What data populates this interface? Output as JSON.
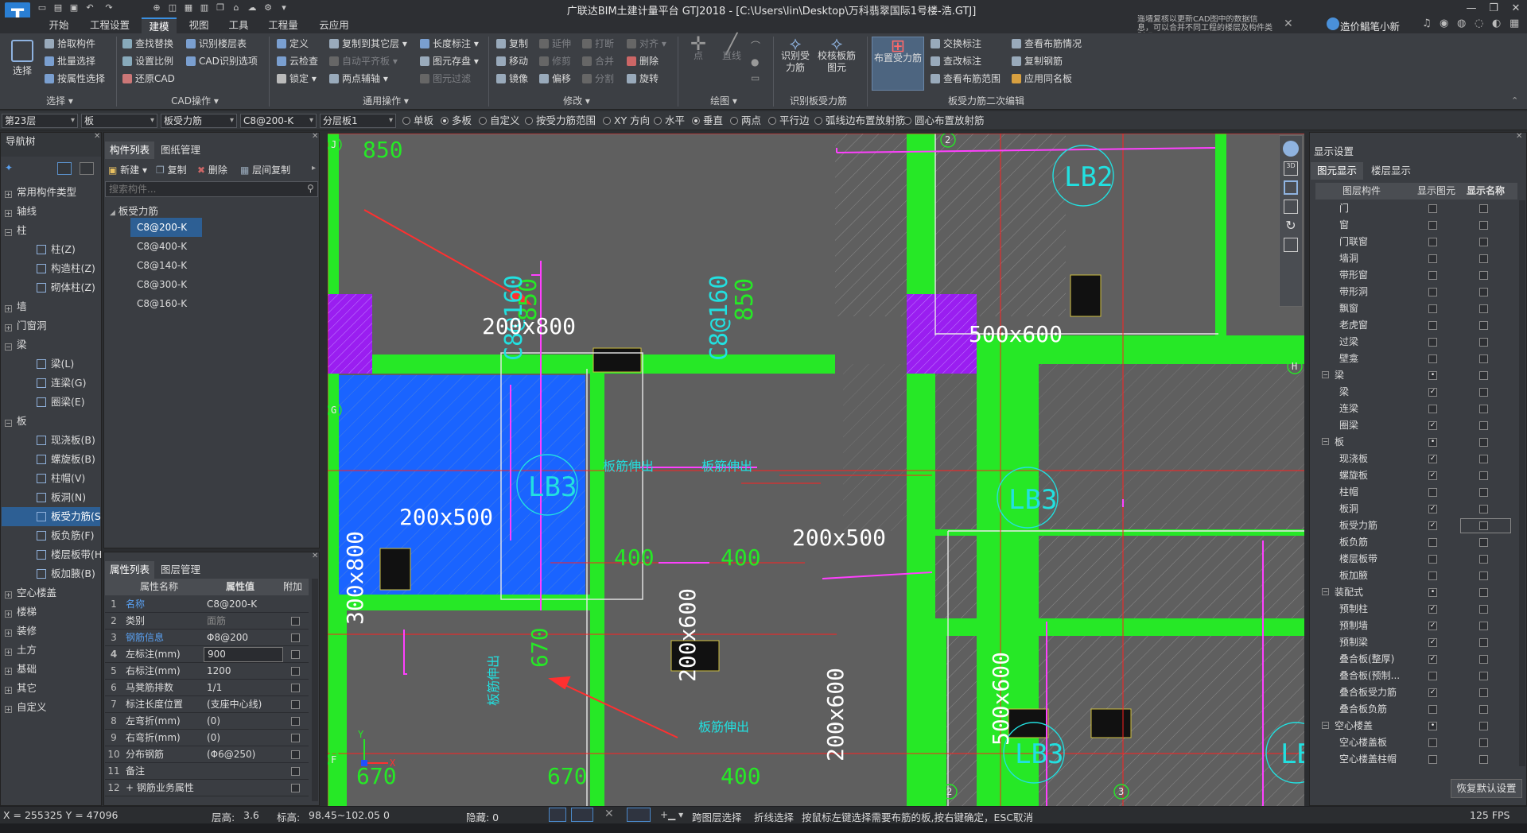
{
  "app": {
    "title": "广联达BIM土建计量平台 GTJ2018 - [C:\\Users\\lin\\Desktop\\万科翡翠国际1号楼-浩.GTJ]",
    "logo": "T",
    "notice": "遥墙复核以更新CAD图中的数据信息，可以合并不同工程的楼层及构件类别吗?",
    "user": "造价鲳笔小新"
  },
  "menu": [
    "开始",
    "工程设置",
    "建模",
    "视图",
    "工具",
    "工程量",
    "云应用"
  ],
  "ribbon": {
    "select": {
      "big": "选择",
      "items": [
        "拾取构件",
        "批量选择",
        "按属性选择"
      ],
      "group": "选择"
    },
    "cad": {
      "items": [
        "查找替换",
        "识别楼层表",
        "设置比例",
        "CAD识别选项",
        "还原CAD"
      ],
      "group": "CAD操作"
    },
    "general": {
      "items": [
        "定义",
        "复制到其它层",
        "长度标注",
        "云检查",
        "自动平齐板",
        "图元存盘",
        "锁定",
        "两点辅轴",
        "图元过滤"
      ],
      "group": "通用操作"
    },
    "modify": {
      "items": [
        "复制",
        "延伸",
        "打断",
        "对齐",
        "移动",
        "修剪",
        "合并",
        "删除",
        "镜像",
        "偏移",
        "分割",
        "旋转"
      ],
      "group": "修改"
    },
    "draw": {
      "items": [
        "点",
        "直线"
      ],
      "group": "绘图"
    },
    "recog": {
      "items": [
        "识别受力筋",
        "校核板筋图元"
      ],
      "group": "识别板受力筋"
    },
    "layout": {
      "big": "布置受力筋",
      "items": [
        "交换标注",
        "查看布筋情况",
        "查改标注",
        "复制钢筋",
        "查看布筋范围",
        "应用同名板"
      ],
      "group": "板受力筋二次编辑"
    }
  },
  "toolbar2": {
    "floor": "第23层",
    "category": "板",
    "type": "板受力筋",
    "spec": "C8@200-K",
    "layer": "分层板1",
    "radios": [
      "单板",
      "多板",
      "自定义",
      "按受力筋范围",
      "XY 方向",
      "水平",
      "垂直",
      "两点",
      "平行边",
      "弧线边布置放射筋",
      "圆心布置放射筋"
    ]
  },
  "nav": {
    "title": "导航树",
    "items": [
      {
        "label": "常用构件类型",
        "level": 0,
        "box": "+"
      },
      {
        "label": "轴线",
        "level": 0,
        "box": "+"
      },
      {
        "label": "柱",
        "level": 0,
        "box": "−"
      },
      {
        "label": "柱(Z)",
        "level": 1
      },
      {
        "label": "构造柱(Z)",
        "level": 1
      },
      {
        "label": "砌体柱(Z)",
        "level": 1
      },
      {
        "label": "墙",
        "level": 0,
        "box": "+"
      },
      {
        "label": "门窗洞",
        "level": 0,
        "box": "+"
      },
      {
        "label": "梁",
        "level": 0,
        "box": "−"
      },
      {
        "label": "梁(L)",
        "level": 1
      },
      {
        "label": "连梁(G)",
        "level": 1
      },
      {
        "label": "圈梁(E)",
        "level": 1
      },
      {
        "label": "板",
        "level": 0,
        "box": "−"
      },
      {
        "label": "现浇板(B)",
        "level": 1
      },
      {
        "label": "螺旋板(B)",
        "level": 1
      },
      {
        "label": "柱帽(V)",
        "level": 1
      },
      {
        "label": "板洞(N)",
        "level": 1
      },
      {
        "label": "板受力筋(S",
        "level": 1,
        "selected": true
      },
      {
        "label": "板负筋(F)",
        "level": 1
      },
      {
        "label": "楼层板带(H",
        "level": 1
      },
      {
        "label": "板加腋(B)",
        "level": 1
      },
      {
        "label": "空心楼盖",
        "level": 0,
        "box": "+"
      },
      {
        "label": "楼梯",
        "level": 0,
        "box": "+"
      },
      {
        "label": "装修",
        "level": 0,
        "box": "+"
      },
      {
        "label": "土方",
        "level": 0,
        "box": "+"
      },
      {
        "label": "基础",
        "level": 0,
        "box": "+"
      },
      {
        "label": "其它",
        "level": 0,
        "box": "+"
      },
      {
        "label": "自定义",
        "level": 0,
        "box": "+"
      }
    ]
  },
  "components": {
    "tabs": [
      "构件列表",
      "图纸管理"
    ],
    "buttons": [
      "新建",
      "复制",
      "删除",
      "层间复制"
    ],
    "search_placeholder": "搜索构件...",
    "group": "板受力筋",
    "items": [
      "C8@200-K",
      "C8@400-K",
      "C8@140-K",
      "C8@300-K",
      "C8@160-K"
    ]
  },
  "properties": {
    "tabs": [
      "属性列表",
      "图层管理"
    ],
    "headers": [
      "属性名称",
      "属性值",
      "附加"
    ],
    "rows": [
      {
        "n": "1",
        "k": "名称",
        "v": "C8@200-K",
        "kc": "blue"
      },
      {
        "n": "2",
        "k": "类别",
        "v": "面筋",
        "vc": "gray"
      },
      {
        "n": "3",
        "k": "钢筋信息",
        "v": "Φ8@200",
        "kc": "blue"
      },
      {
        "n": "4",
        "k": "左标注(mm)",
        "v": "900",
        "edit": true
      },
      {
        "n": "5",
        "k": "右标注(mm)",
        "v": "1200"
      },
      {
        "n": "6",
        "k": "马凳筋排数",
        "v": "1/1"
      },
      {
        "n": "7",
        "k": "标注长度位置",
        "v": "(支座中心线)"
      },
      {
        "n": "8",
        "k": "左弯折(mm)",
        "v": "(0)"
      },
      {
        "n": "9",
        "k": "右弯折(mm)",
        "v": "(0)"
      },
      {
        "n": "10",
        "k": "分布钢筋",
        "v": "(Φ6@250)"
      },
      {
        "n": "11",
        "k": "备注",
        "v": ""
      },
      {
        "n": "12",
        "k": "+ 钢筋业务属性",
        "v": ""
      }
    ]
  },
  "canvas": {
    "texts": {
      "dim850a": "850",
      "dim850b": "850",
      "rebar1": "C8@160",
      "rebar2": "C8@160",
      "beam200x800": "200x800",
      "beam500x600": "500x600",
      "beam300x800": "300x800",
      "beam200x500a": "200x500",
      "beam200x500b": "200x500",
      "beam200x600a": "200x600",
      "beam200x600b": "200x600",
      "beam500x600b": "500x600",
      "lb2": "LB2",
      "lb3a": "LB3",
      "lb3b": "LB3",
      "lb3c": "LB3",
      "lb3d": "LB",
      "stretch1": "板筋伸出",
      "stretch2": "板筋伸出",
      "stretch3": "板筋伸出",
      "stretch4": "板筋伸出",
      "n400a": "400",
      "n400b": "400",
      "n400c": "400",
      "n670a": "670",
      "n670b": "670",
      "n670c": "670",
      "n400d": "400",
      "axisJ": "J",
      "axisG": "G",
      "axisF": "F",
      "axisH": "H",
      "axis2a": "2",
      "axis2b": "2",
      "axis3": "3"
    }
  },
  "display": {
    "title": "显示设置",
    "tabs": [
      "图元显示",
      "楼层显示"
    ],
    "headers": [
      "图层构件",
      "显示图元",
      "显示名称"
    ],
    "rows": [
      {
        "label": "门",
        "a": false,
        "b": false
      },
      {
        "label": "窗",
        "a": false,
        "b": false
      },
      {
        "label": "门联窗",
        "a": false,
        "b": false
      },
      {
        "label": "墙洞",
        "a": false,
        "b": false
      },
      {
        "label": "带形窗",
        "a": false,
        "b": false
      },
      {
        "label": "带形洞",
        "a": false,
        "b": false
      },
      {
        "label": "飘窗",
        "a": false,
        "b": false
      },
      {
        "label": "老虎窗",
        "a": false,
        "b": false
      },
      {
        "label": "过梁",
        "a": false,
        "b": false
      },
      {
        "label": "壁龛",
        "a": false,
        "b": false
      },
      {
        "label": "梁",
        "group": true,
        "a": "dot",
        "b": false
      },
      {
        "label": "梁",
        "a": true,
        "b": false
      },
      {
        "label": "连梁",
        "a": false,
        "b": false
      },
      {
        "label": "圈梁",
        "a": true,
        "b": false
      },
      {
        "label": "板",
        "group": true,
        "a": "dot",
        "b": false
      },
      {
        "label": "现浇板",
        "a": true,
        "b": false
      },
      {
        "label": "螺旋板",
        "a": true,
        "b": false
      },
      {
        "label": "柱帽",
        "a": false,
        "b": false
      },
      {
        "label": "板洞",
        "a": true,
        "b": false
      },
      {
        "label": "板受力筋",
        "a": true,
        "b": false,
        "hl": true
      },
      {
        "label": "板负筋",
        "a": false,
        "b": false
      },
      {
        "label": "楼层板带",
        "a": false,
        "b": false
      },
      {
        "label": "板加腋",
        "a": false,
        "b": false
      },
      {
        "label": "装配式",
        "group": true,
        "a": "dot",
        "b": false
      },
      {
        "label": "预制柱",
        "a": true,
        "b": false
      },
      {
        "label": "预制墙",
        "a": true,
        "b": false
      },
      {
        "label": "预制梁",
        "a": true,
        "b": false
      },
      {
        "label": "叠合板(整厚)",
        "a": true,
        "b": false
      },
      {
        "label": "叠合板(预制...",
        "a": false,
        "b": false
      },
      {
        "label": "叠合板受力筋",
        "a": true,
        "b": false
      },
      {
        "label": "叠合板负筋",
        "a": false,
        "b": false
      },
      {
        "label": "空心楼盖",
        "group": true,
        "a": "dot",
        "b": false
      },
      {
        "label": "空心楼盖板",
        "a": false,
        "b": false
      },
      {
        "label": "空心楼盖柱帽",
        "a": false,
        "b": false
      }
    ],
    "reset": "恢复默认设置"
  },
  "status": {
    "coords": "X = 255325 Y = 47096",
    "floor_height_label": "层高:",
    "floor_height": "3.6",
    "elev_label": "标高:",
    "elev": "98.45~102.05",
    "zero": "0",
    "hidden": "隐藏: 0",
    "cross_layer": "跨图层选择",
    "polyline": "折线选择",
    "hint": "按鼠标左键选择需要布筋的板,按右键确定，ESC取消",
    "fps": "125 FPS"
  }
}
